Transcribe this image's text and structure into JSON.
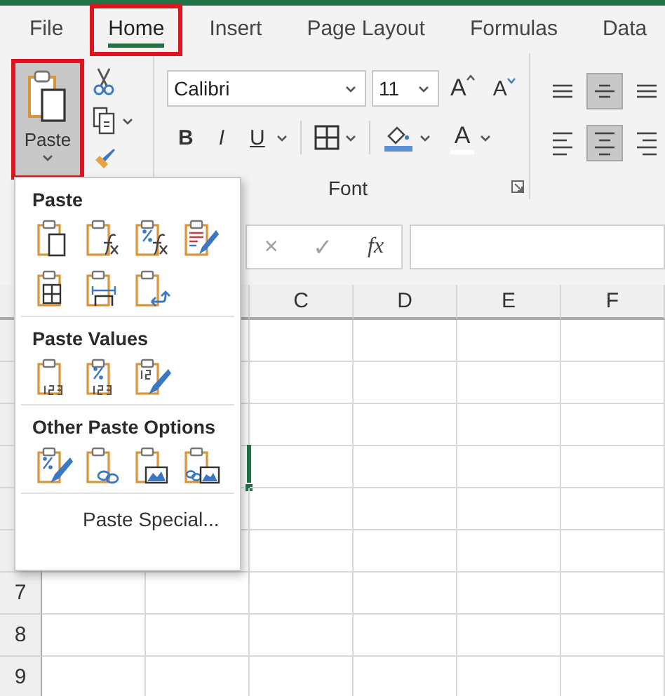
{
  "tabs": [
    {
      "label": "File",
      "selected": false,
      "highlighted": false
    },
    {
      "label": "Home",
      "selected": true,
      "highlighted": true
    },
    {
      "label": "Insert",
      "selected": false,
      "highlighted": false
    },
    {
      "label": "Page Layout",
      "selected": false,
      "highlighted": false
    },
    {
      "label": "Formulas",
      "selected": false,
      "highlighted": false
    },
    {
      "label": "Data",
      "selected": false,
      "highlighted": false
    }
  ],
  "ribbon": {
    "paste_button": {
      "label": "Paste",
      "highlighted": true
    },
    "font_group": {
      "title": "Font",
      "font_name": "Calibri",
      "font_size": "11",
      "grow": "A",
      "shrink": "A",
      "bold": "B",
      "italic": "I",
      "underline": "U",
      "font_color": "A"
    },
    "alignment_buttons": [
      {
        "kind": "top",
        "selected": false
      },
      {
        "kind": "middle",
        "selected": true
      },
      {
        "kind": "bottom",
        "selected": false
      },
      {
        "kind": "left",
        "selected": false
      },
      {
        "kind": "center",
        "selected": true
      },
      {
        "kind": "right",
        "selected": false
      }
    ]
  },
  "formula_bar": {
    "cancel": "×",
    "enter": "✓",
    "function": "fx"
  },
  "grid": {
    "columns": [
      "C",
      "D",
      "E",
      "F"
    ],
    "row_headers": [
      "7",
      "8",
      "9"
    ],
    "selection_visible": true
  },
  "paste_menu": {
    "sections": [
      {
        "title": "Paste",
        "options": [
          {
            "kind": "all"
          },
          {
            "kind": "formulas"
          },
          {
            "kind": "formulas-number"
          },
          {
            "kind": "keep-source"
          },
          {
            "kind": "no-borders"
          },
          {
            "kind": "column-widths"
          },
          {
            "kind": "transpose"
          }
        ]
      },
      {
        "title": "Paste Values",
        "options": [
          {
            "kind": "values"
          },
          {
            "kind": "values-number"
          },
          {
            "kind": "values-source"
          }
        ]
      },
      {
        "title": "Other Paste Options",
        "options": [
          {
            "kind": "formatting"
          },
          {
            "kind": "link"
          },
          {
            "kind": "picture"
          },
          {
            "kind": "linked-picture"
          }
        ]
      }
    ],
    "paste_special": {
      "label": "Paste Special..."
    }
  }
}
